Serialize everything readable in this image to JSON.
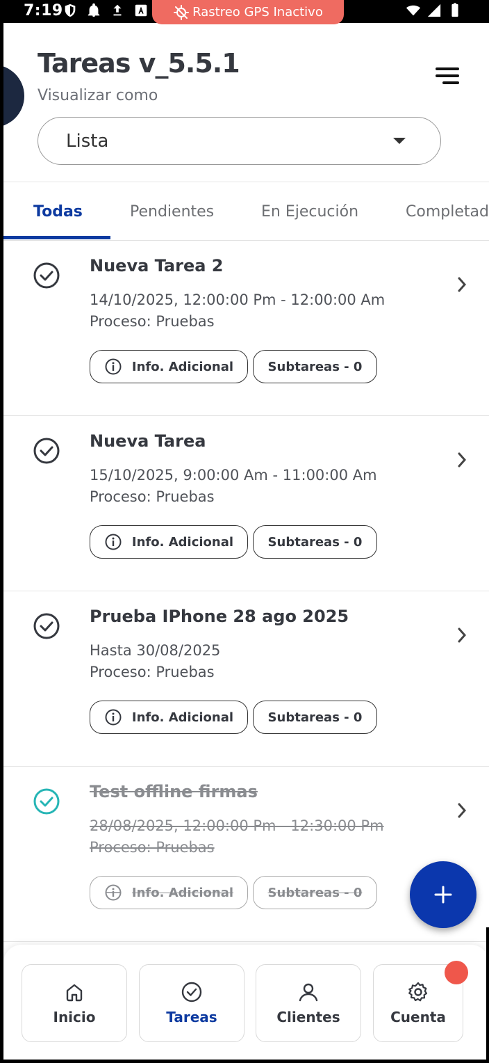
{
  "status_bar": {
    "time": "7:19"
  },
  "gps_banner": {
    "label": "Rastreo GPS Inactivo"
  },
  "header": {
    "title": "Tareas v_5.5.1",
    "subtitle": "Visualizar como"
  },
  "view_select": {
    "selected": "Lista"
  },
  "tabs": [
    {
      "label": "Todas",
      "active": true
    },
    {
      "label": "Pendientes",
      "active": false
    },
    {
      "label": "En Ejecución",
      "active": false
    },
    {
      "label": "Completad",
      "active": false
    }
  ],
  "tasks": [
    {
      "title": "Nueva Tarea 2",
      "date": "14/10/2025, 12:00:00 Pm - 12:00:00 Am",
      "process": "Proceso: Pruebas",
      "info_label": "Info. Adicional",
      "subtasks_label": "Subtareas - 0",
      "completed": false
    },
    {
      "title": "Nueva Tarea",
      "date": "15/10/2025, 9:00:00 Am - 11:00:00 Am",
      "process": "Proceso: Pruebas",
      "info_label": "Info. Adicional",
      "subtasks_label": "Subtareas - 0",
      "completed": false
    },
    {
      "title": "Prueba IPhone 28 ago 2025",
      "date": "Hasta 30/08/2025",
      "process": "Proceso: Pruebas",
      "info_label": "Info. Adicional",
      "subtasks_label": "Subtareas - 0",
      "completed": false
    },
    {
      "title": "Test offline firmas",
      "date": "28/08/2025, 12:00:00 Pm - 12:30:00 Pm",
      "process": "Proceso: Pruebas",
      "info_label": "Info. Adicional",
      "subtasks_label": "Subtareas - 0",
      "completed": true
    }
  ],
  "bottom_nav": [
    {
      "label": "Inicio",
      "icon": "home-icon",
      "active": false
    },
    {
      "label": "Tareas",
      "icon": "check-circle-icon",
      "active": true
    },
    {
      "label": "Clientes",
      "icon": "user-icon",
      "active": false
    },
    {
      "label": "Cuenta",
      "icon": "gear-icon",
      "active": false,
      "badge": true
    }
  ],
  "colors": {
    "primary": "#0d3aa0",
    "fab": "#0b37ad",
    "gps_banner": "#ef6b61",
    "done_check": "#26b5b5",
    "badge": "#ef574b"
  }
}
